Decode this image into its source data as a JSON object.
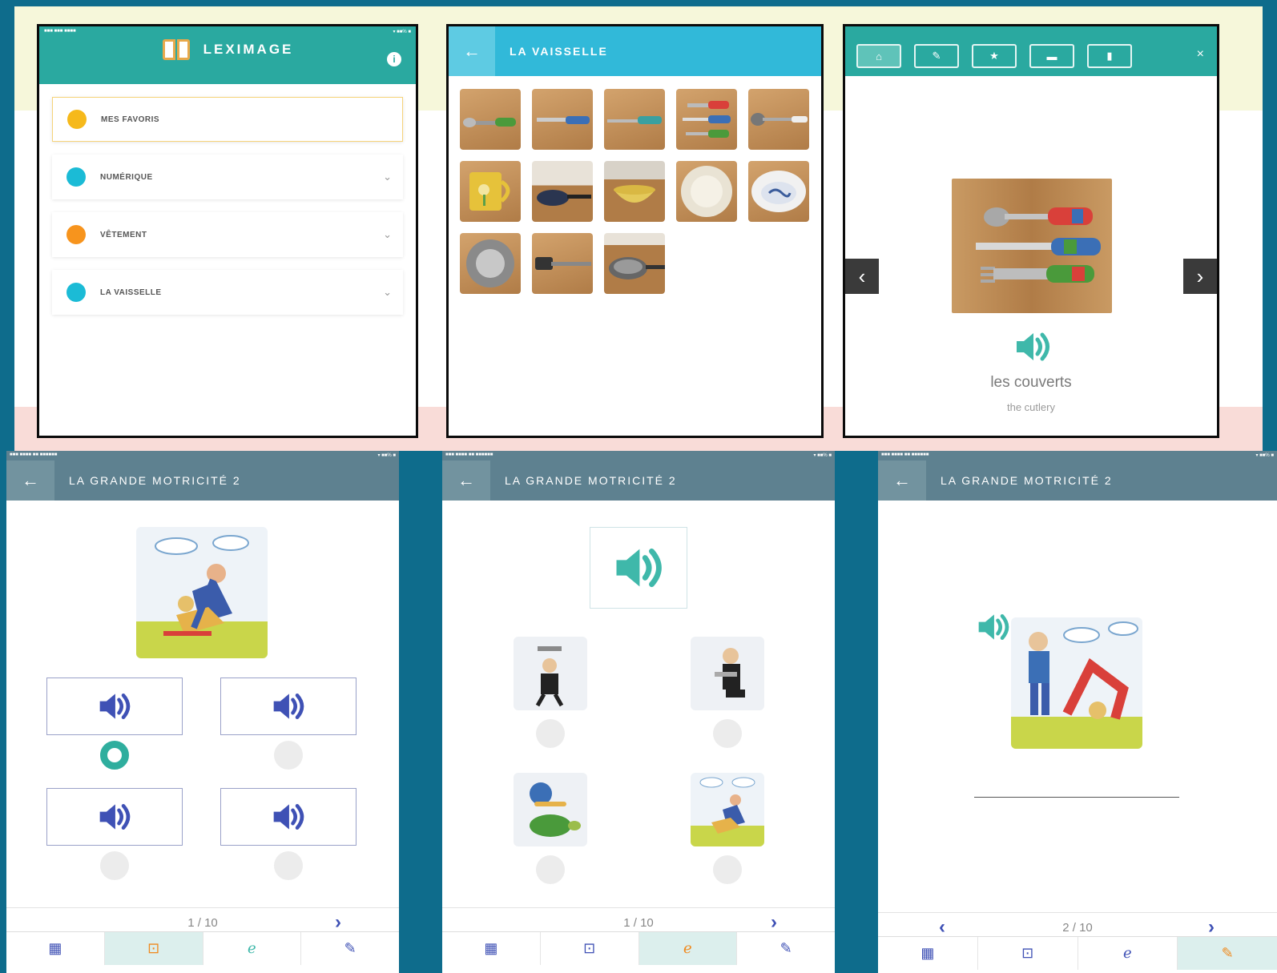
{
  "colors": {
    "page_background": "#0e6c8c",
    "leximage_teal": "#2aa9a0",
    "vaisselle_blue": "#31b9d9",
    "exercise_header": "#5e8190",
    "speaker_indigo": "#3f51b5",
    "speaker_teal": "#3fb8aa"
  },
  "screen1": {
    "app_title": "LEXIMAGE",
    "info_icon_glyph": "i",
    "categories": [
      {
        "label": "MES FAVORIS",
        "dot_color": "#f6b91b",
        "icon": "none"
      },
      {
        "label": "NUMÉRIQUE",
        "dot_color": "#1bbbd6",
        "icon": "chevron-down-icon"
      },
      {
        "label": "VÊTEMENT",
        "dot_color": "#f7941d",
        "icon": "chevron-down-icon"
      },
      {
        "label": "LA VAISSELLE",
        "dot_color": "#1bbbd6",
        "icon": "chevron-down-icon"
      }
    ]
  },
  "screen2": {
    "back_glyph": "←",
    "title": "LA VAISSELLE",
    "thumbnail_count": 13
  },
  "screen3": {
    "toolbar_icons": [
      "home-icon",
      "pencil-icon",
      "star-icon",
      "folder-icon",
      "trash-icon"
    ],
    "close_glyph": "×",
    "word": "les couverts",
    "translation": "the cutlery",
    "prev_glyph": "‹",
    "next_glyph": "›"
  },
  "exercise_title": "LA GRANDE MOTRICITÉ 2",
  "exercise_back_glyph": "←",
  "exercise1": {
    "pager": "1 / 10",
    "selected_option": 1
  },
  "exercise2": {
    "pager": "1 / 10"
  },
  "exercise3": {
    "pager": "2 / 10"
  },
  "tab_icons": [
    "grid-icon",
    "image-card-icon",
    "ear-icon",
    "pencil-icon"
  ]
}
